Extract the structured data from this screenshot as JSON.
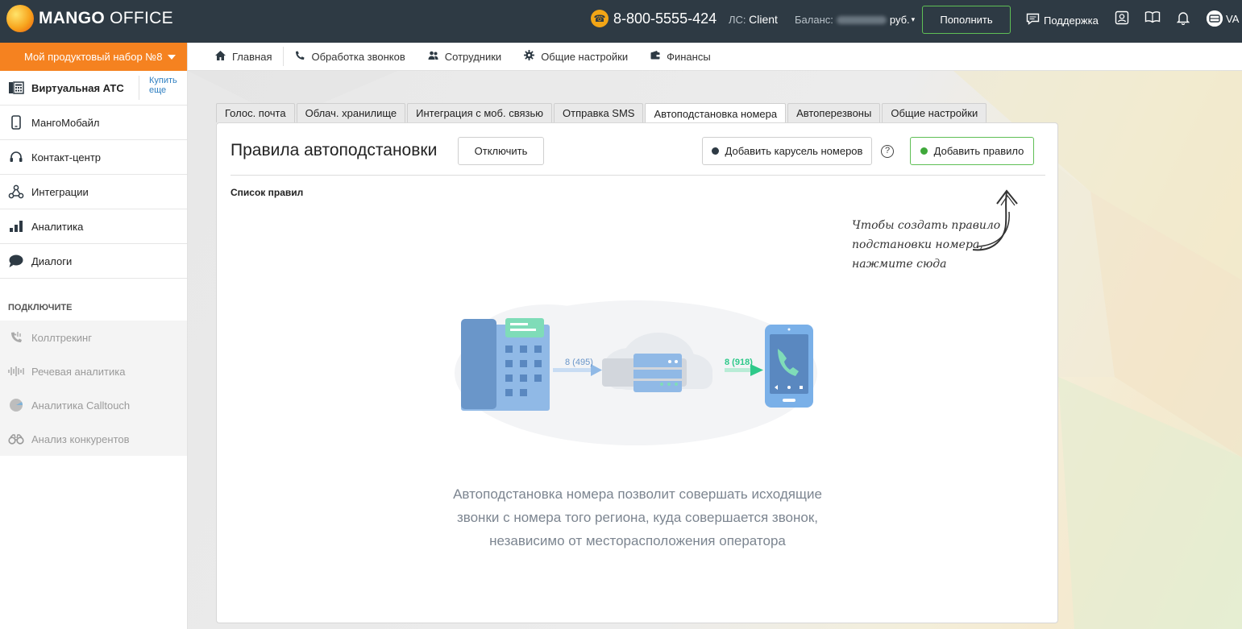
{
  "header": {
    "logo_text_bold": "MANGO",
    "logo_text_light": " OFFICE",
    "phone": "8-800-5555-424",
    "account_label": "ЛС:",
    "account_value": "Client",
    "balance_label": "Баланс:",
    "currency": "руб.",
    "topup_label": "Пополнить",
    "support_label": "Поддержка",
    "user_initials": "VA"
  },
  "sidebar": {
    "product": "Мой продуктовый набор №8",
    "items": [
      {
        "label": "Виртуальная АТС",
        "icon": "pbx-icon"
      },
      {
        "label": "МангоМобайл",
        "icon": "mobile-icon"
      },
      {
        "label": "Контакт-центр",
        "icon": "headset-icon"
      },
      {
        "label": "Интеграции",
        "icon": "integrations-icon"
      },
      {
        "label": "Аналитика",
        "icon": "bar-chart-icon"
      },
      {
        "label": "Диалоги",
        "icon": "chat-icon"
      }
    ],
    "buy_more": "Купить еще",
    "connect_title": "ПОДКЛЮЧИТЕ",
    "connect_items": [
      {
        "label": "Коллтрекинг",
        "icon": "calltracking-icon"
      },
      {
        "label": "Речевая аналитика",
        "icon": "waveform-icon"
      },
      {
        "label": "Аналитика Calltouch",
        "icon": "calltouch-icon"
      },
      {
        "label": "Анализ конкурентов",
        "icon": "binoculars-icon"
      }
    ]
  },
  "nav": [
    {
      "label": "Главная",
      "icon": "home-icon"
    },
    {
      "label": "Обработка звонков",
      "icon": "phone-icon"
    },
    {
      "label": "Сотрудники",
      "icon": "people-icon"
    },
    {
      "label": "Общие настройки",
      "icon": "gear-icon"
    },
    {
      "label": "Финансы",
      "icon": "wallet-icon"
    }
  ],
  "tabs": [
    "Голос. почта",
    "Облач. хранилище",
    "Интеграция с моб. связью",
    "Отправка SMS",
    "Автоподстановка номера",
    "Автоперезвоны",
    "Общие настройки"
  ],
  "active_tab": "Автоподстановка номера",
  "card": {
    "title": "Правила автоподстановки",
    "disable_label": "Отключить",
    "carousel_label": "Добавить карусель номеров",
    "help": "?",
    "add_rule_label": "Добавить правило",
    "list_label": "Список правил",
    "hint_line1": "Чтобы создать правило",
    "hint_line2": "подстановки номера,",
    "hint_line3": "нажмите сюда",
    "illus_code_left": "8 (495)",
    "illus_code_right": "8 (918)",
    "desc_line1": "Автоподстановка номера позволит совершать исходящие",
    "desc_line2": "звонки с номера того региона, куда совершается звонок,",
    "desc_line3": "независимо от месторасположения оператора"
  },
  "colors": {
    "topbar": "#2e3a44",
    "accent_orange": "#f58220",
    "accent_green": "#5fbf55",
    "link_blue": "#2f7fc1"
  }
}
